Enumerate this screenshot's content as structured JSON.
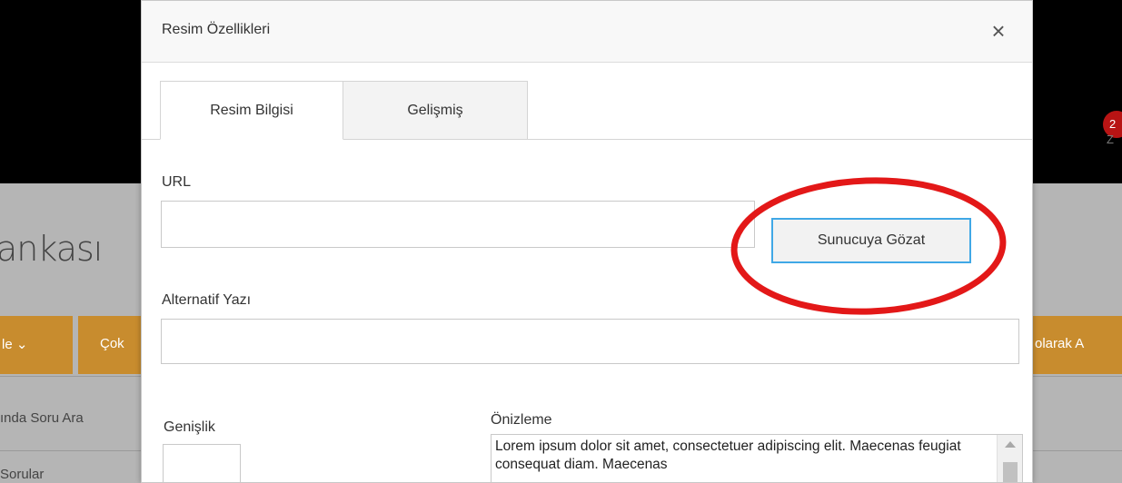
{
  "background": {
    "badge_count": "2",
    "badge_tail": "Z",
    "page_title_fragment": "ankası",
    "nav_button_1": "le ⌄",
    "nav_button_2": "Çok",
    "nav_button_3": "olarak A",
    "row_text_1": "ında Soru Ara",
    "row_text_2": "Sorular"
  },
  "dialog": {
    "title": "Resim Özellikleri",
    "close_icon": "×",
    "tabs": [
      {
        "label": "Resim Bilgisi",
        "active": true
      },
      {
        "label": "Gelişmiş",
        "active": false
      }
    ],
    "url": {
      "label": "URL",
      "value": ""
    },
    "browse_button_label": "Sunucuya Gözat",
    "alt_text": {
      "label": "Alternatif Yazı",
      "value": ""
    },
    "width": {
      "label": "Genişlik",
      "value": ""
    },
    "preview": {
      "label": "Önizleme",
      "text": "Lorem ipsum dolor sit amet, consectetuer adipiscing elit. Maecenas feugiat consequat diam. Maecenas"
    }
  },
  "colors": {
    "highlight_circle": "#e31818",
    "focus_border": "#40a8e6",
    "background_orange": "#c88c2e"
  }
}
